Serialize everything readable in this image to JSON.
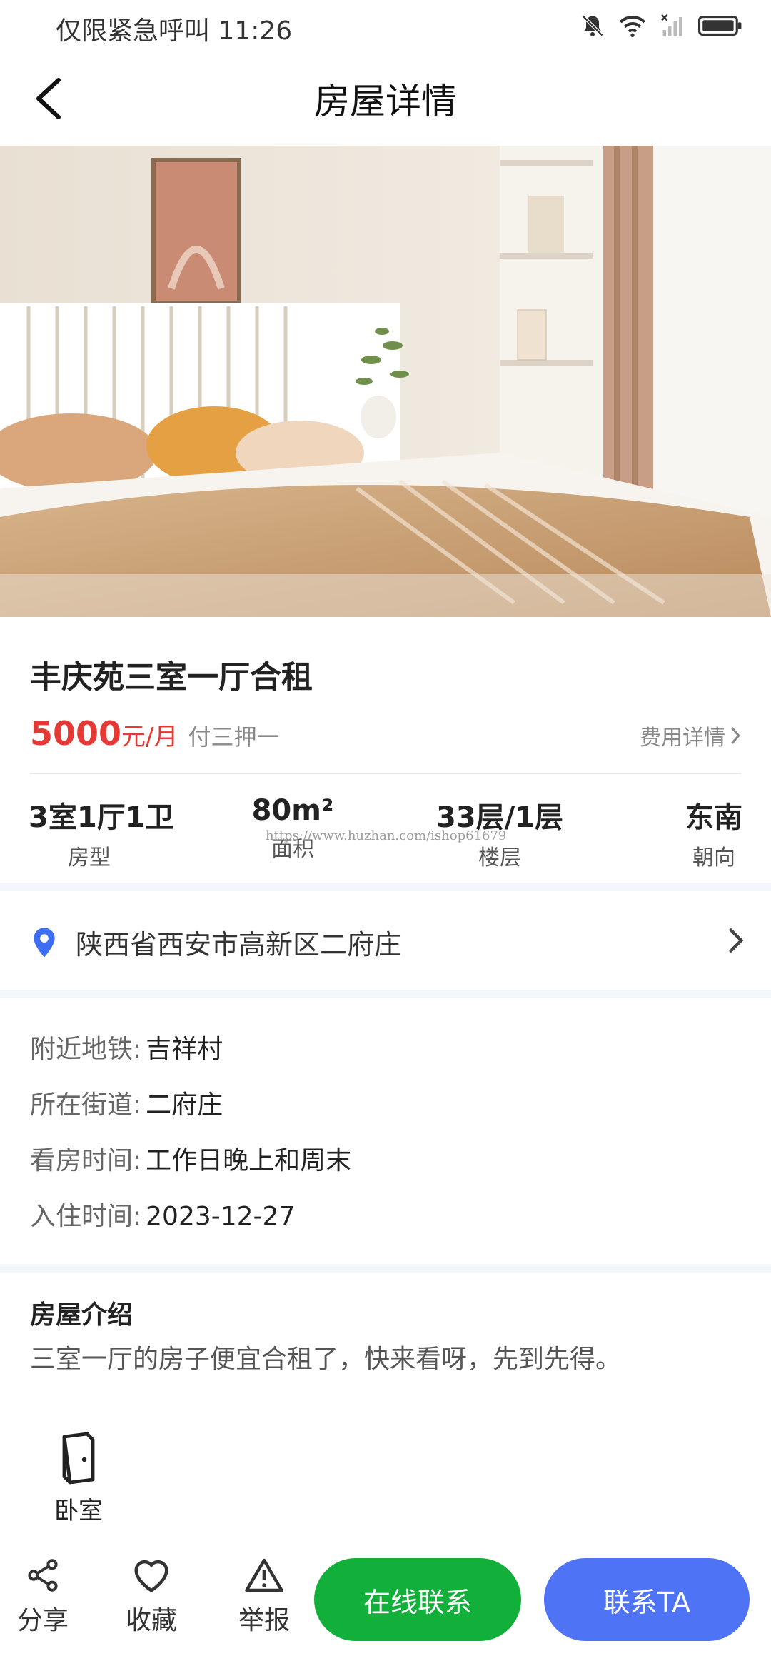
{
  "status_bar": {
    "left_text": "仅限紧急呼叫 11:26"
  },
  "nav": {
    "title": "房屋详情"
  },
  "house": {
    "title": "丰庆苑三室一厅合租",
    "price": "5000",
    "price_unit": "元/月",
    "pay_type": "付三押一",
    "fee_link": "费用详情"
  },
  "specs": [
    {
      "value": "3室1厅1卫",
      "label": "房型"
    },
    {
      "value": "80m²",
      "label": "面积"
    },
    {
      "value": "33层/1层",
      "label": "楼层"
    },
    {
      "value": "东南",
      "label": "朝向"
    }
  ],
  "watermark": "https://www.huzhan.com/ishop61679",
  "location": {
    "address": "陕西省西安市高新区二府庄"
  },
  "details": [
    {
      "key": "附近地铁:",
      "value": "吉祥村"
    },
    {
      "key": "所在街道:",
      "value": "二府庄"
    },
    {
      "key": "看房时间:",
      "value": "工作日晚上和周末"
    },
    {
      "key": "入住时间:",
      "value": "2023-12-27"
    }
  ],
  "intro": {
    "title": "房屋介绍",
    "text": "三室一厅的房子便宜合租了，快来看呀，先到先得。",
    "facility_label": "卧室"
  },
  "bottom_bar": {
    "share": "分享",
    "favorite": "收藏",
    "report": "举报",
    "online_contact": "在线联系",
    "contact": "联系TA"
  },
  "colors": {
    "price_red": "#e53935",
    "online_green": "#12b03a",
    "contact_blue": "#4e74f5",
    "pin_blue": "#3d6df2"
  }
}
